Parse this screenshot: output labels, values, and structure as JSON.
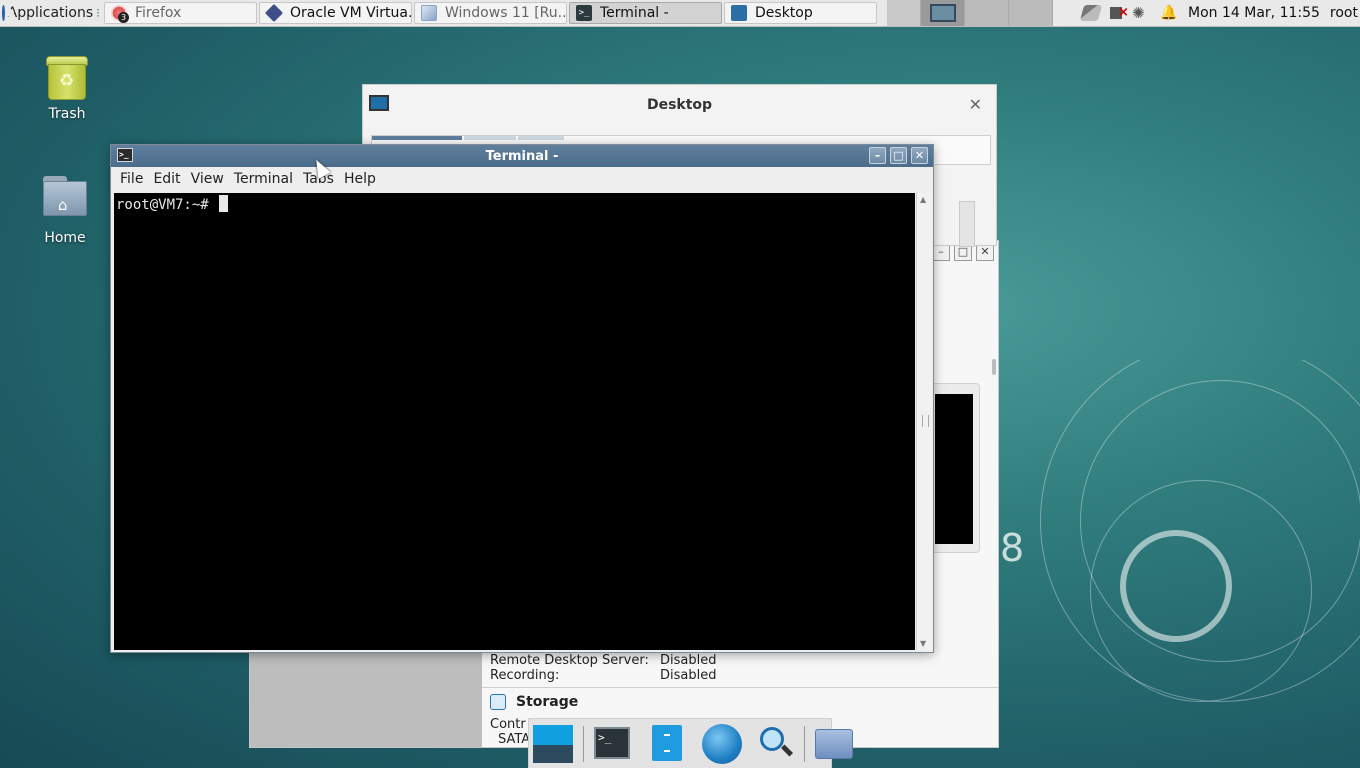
{
  "top_panel": {
    "applications_label": "Applications",
    "tasks": [
      {
        "label": "Firefox",
        "badge": "3"
      },
      {
        "label": "Oracle VM Virtua..."
      },
      {
        "label": "Windows 11 [Ru..."
      },
      {
        "label": "Terminal -"
      },
      {
        "label": "Desktop"
      }
    ],
    "clock": "Mon 14 Mar, 11:55",
    "user": "root"
  },
  "desktop_icons": {
    "trash_label": "Trash",
    "home_label": "Home"
  },
  "vbox_window": {
    "title": "Desktop"
  },
  "details_window": {
    "rows": [
      {
        "key": "Remote Desktop Server:",
        "value": "Disabled"
      },
      {
        "key": "Recording:",
        "value": "Disabled"
      }
    ],
    "storage_heading": "Storage",
    "controller_text": "Contr",
    "sata_text": "SATA",
    "tail_text": ")",
    "big_digit": "8"
  },
  "terminal": {
    "title": "Terminal -",
    "menu": [
      "File",
      "Edit",
      "View",
      "Terminal",
      "Tabs",
      "Help"
    ],
    "prompt": "root@VM7:~# "
  },
  "colors": {
    "terminal_titlebar": "#5a7a98",
    "terminal_bg": "#000000",
    "desktop_bg": "#2f7b7c"
  }
}
